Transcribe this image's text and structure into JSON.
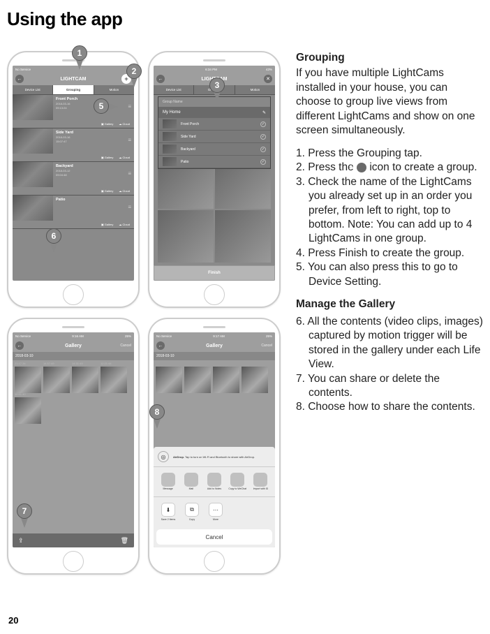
{
  "page_title": "Using the app",
  "page_number": "20",
  "phone1": {
    "status_left": "No Service",
    "app_title": "LIGHTCAM",
    "tabs": [
      "Device List",
      "Grouping",
      "Motion"
    ],
    "cams": [
      {
        "name": "Front Porch",
        "date": "2018-03-16",
        "time": "09:13:24",
        "btn1": "Gallery",
        "btn2": "Cloud"
      },
      {
        "name": "Side Yard",
        "date": "2018-03-16",
        "time": "15:07:47",
        "btn1": "Gallery",
        "btn2": "Cloud"
      },
      {
        "name": "Backyard",
        "date": "2018-03-12",
        "time": "09:04:48",
        "btn1": "Gallery",
        "btn2": "Cloud"
      },
      {
        "name": "Patio",
        "date": "",
        "time": "",
        "btn1": "Gallery",
        "btn2": "Cloud"
      }
    ]
  },
  "phone2": {
    "time": "6:34 PM",
    "battery": "43%",
    "app_title": "LIGHTCAM",
    "tabs": [
      "Device List",
      "Grouping",
      "Motion"
    ],
    "group_name_label": "Group Name",
    "group_name_value": "My Home",
    "items": [
      {
        "name": "Front Porch"
      },
      {
        "name": "Side Yard"
      },
      {
        "name": "Backyard"
      },
      {
        "name": "Patio"
      }
    ],
    "finish_label": "Finish"
  },
  "phone3": {
    "status_left": "No Service",
    "time": "9:16 AM",
    "battery": "25%",
    "header": "Gallery",
    "cancel": "Cancel",
    "date": "2018-03-10",
    "times": [
      "21:17 34",
      "14:57:49",
      "14:31:49",
      "12:21:44",
      "10:51:40"
    ]
  },
  "phone4": {
    "status_left": "No Service",
    "time": "9:17 AM",
    "battery": "25%",
    "header": "Gallery",
    "cancel": "Cancel",
    "date": "2018-03-10",
    "airdrop_title": "AirDrop.",
    "airdrop_text": "Tap to turn on Wi-Fi and Bluetooth to share with AirDrop.",
    "apps": [
      "Message",
      "Mail",
      "Add to Notes",
      "Copy to WeChat",
      "Import with iD"
    ],
    "actions": [
      "Save 2 Items",
      "Copy",
      "More"
    ],
    "cancel_btn": "Cancel"
  },
  "callouts": {
    "c1": "1",
    "c2": "2",
    "c3": "3",
    "c5": "5",
    "c6": "6",
    "c7": "7",
    "c8": "8"
  },
  "text": {
    "grouping_heading": "Grouping",
    "grouping_intro": "If you have multiple LightCams installed in your house, you can choose to group live views from different LightCams and show on one screen simultaneously.",
    "step1": "1.  Press the Grouping tap.",
    "step2a": "2. Press the ",
    "step2b": " icon to create a group.",
    "step3": "3. Check the name of the LightCams you already set up in an order you prefer, from left to right, top to bottom. Note: You can add up to 4 LightCams in one group.",
    "step4": "4. Press Finish to create the group.",
    "step5": "5. You can also press this to go to Device Setting.",
    "gallery_heading": "Manage the Gallery",
    "step6": "6. All the contents (video clips, images) captured by motion trigger will be stored in the gallery under each Life View.",
    "step7": "7. You can share or delete the contents.",
    "step8": "8. Choose how to share the contents."
  }
}
